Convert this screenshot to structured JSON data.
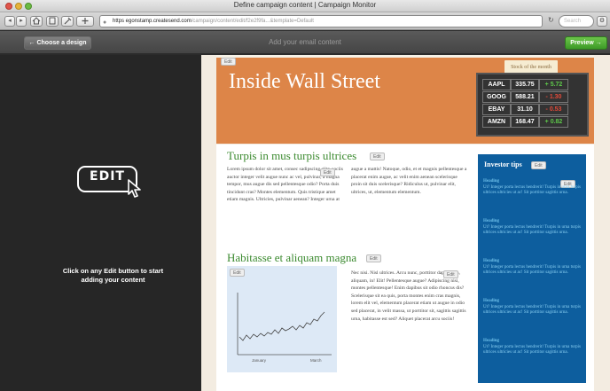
{
  "browser": {
    "window_title": "Define campaign content | Campaign Monitor",
    "url_host": "https  egonstamp.createsend.com",
    "url_path": "/campaign/content/edit/f2e2f9fa...&template=Default",
    "search_placeholder": "Search",
    "reload_icon": "reload-icon",
    "nav": [
      "◂",
      "▸"
    ]
  },
  "appbar": {
    "choose_label": "← Choose a design",
    "title": "Add your email content",
    "preview_label": "Preview →"
  },
  "left": {
    "edit_word": "EDIT",
    "instruction": "Click on any Edit button to start adding your content"
  },
  "newsletter": {
    "title": "Inside Wall Street",
    "edit_label": "Edit",
    "stock_label": "Stock of the month",
    "stocks": [
      {
        "symbol": "AAPL",
        "value": "335.75",
        "change": "+ 5.72",
        "direction": "up"
      },
      {
        "symbol": "GOOG",
        "value": "588.21",
        "change": "- 1.30",
        "direction": "down"
      },
      {
        "symbol": "EBAY",
        "value": "31.10",
        "change": "- 0.53",
        "direction": "down"
      },
      {
        "symbol": "AMZN",
        "value": "168.47",
        "change": "+ 0.82",
        "direction": "up"
      }
    ],
    "section1": {
      "heading": "Turpis in mus turpis ultrices",
      "col1": "Lorem ipsum dolor sit amet, consec sadipscing elitr, sociis auctor integer velit augue nunc ac vel, pulvinar, a magna tempor, mus augue dis sed pellentesque odio? Porta duis tincidunt cras? Montes elementum. Quis tristique amet etiam magnis. Ultricies, pulvinar aenean? Integer urna at",
      "col2": "augue a mattis! Natoque, odio, et et magnis pellentesque a placerat enim augue, ac velit enim aenean scelerisque proin sit duis scelerisque? Ridiculus ut, pulvinar elit, ultrices, ut, elementum elementum."
    },
    "section2": {
      "heading": "Habitasse et aliquam magna",
      "text": "Nec nisi. Nisl ultrices. Arcu nunc, porttitor dapibus, in, aliquam, in! Elit! Pellentesque augue? Adipiscing nisi, montes pellentesque! Enim dapibus sit odio rhoncus dis? Scelerisque sit ea quis, porta montes enim cras magnis, lorem elit vel, elementum placerat etiam ut augue in odio sed placerat, in velit massa, ut porttitor sit, sagittis sagittis urna, habitasse est sed? Aliquet placerat arcu sociis!",
      "chart_x_labels": [
        "January",
        "March"
      ]
    },
    "sidebar": {
      "title": "Investor tips",
      "items": [
        {
          "heading": "Heading",
          "text": "Ut? Integer porta lectus hendrerit! Turpis in urna turpis ultrices ultricies ut ac! Sit porttitor sagittis urna."
        },
        {
          "heading": "Heading",
          "text": "Ut? Integer porta lectus hendrerit! Turpis in urna turpis ultrices ultricies ut ac! Sit porttitor sagittis urna."
        },
        {
          "heading": "Heading",
          "text": "Ut? Integer porta lectus hendrerit! Turpis in urna turpis ultrices ultricies ut ac! Sit porttitor sagittis urna."
        },
        {
          "heading": "Heading",
          "text": "Ut? Integer porta lectus hendrerit! Turpis in urna turpis ultrices ultricies ut ac! Sit porttitor sagittis urna."
        },
        {
          "heading": "Heading",
          "text": "Ut? Integer porta lectus hendrerit! Turpis in urna turpis ultrices ultricies ut ac! Sit porttitor sagittis urna."
        }
      ]
    }
  },
  "colors": {
    "header_orange": "#dd8548",
    "heading_green": "#3b8a2f",
    "sidebar_blue": "#0d5e9e",
    "preview_green": "#3d9a27"
  }
}
